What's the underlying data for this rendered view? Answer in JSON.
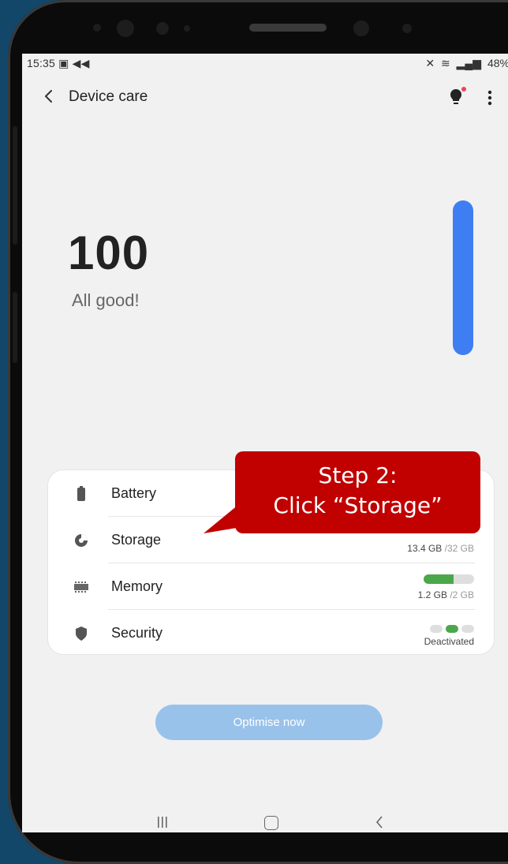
{
  "status": {
    "time": "15:35",
    "battery": "48%"
  },
  "header": {
    "title": "Device care"
  },
  "score": {
    "value": "100",
    "label": "All good!",
    "level": 1.0,
    "bar_color": "#3f7ef2"
  },
  "items": [
    {
      "label": "Battery",
      "icon": "battery-icon"
    },
    {
      "label": "Storage",
      "icon": "storage-pie-icon",
      "used": "13.4 GB",
      "total": " /32 GB",
      "used_fraction": 0.42
    },
    {
      "label": "Memory",
      "icon": "memory-chip-icon",
      "used": "1.2 GB",
      "total": " /2 GB",
      "used_fraction": 0.6
    },
    {
      "label": "Security",
      "icon": "shield-icon",
      "status": "Deactivated",
      "segments_on": 1
    }
  ],
  "actions": {
    "optimise_label": "Optimise now"
  },
  "callout": {
    "line1": "Step 2:",
    "line2": "Click “Storage”",
    "color": "#c10000"
  },
  "colors": {
    "accent_green": "#4ca74b",
    "button_blue": "#99c2ea"
  }
}
